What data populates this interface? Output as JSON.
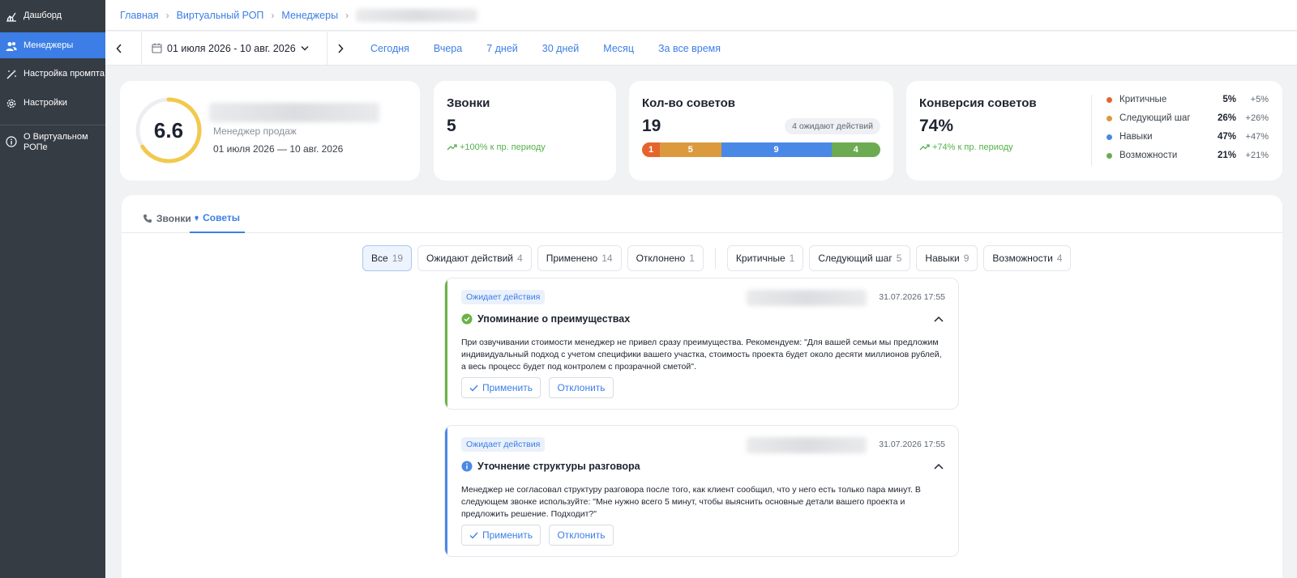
{
  "sidebar": {
    "items": [
      {
        "label": "Дашборд",
        "icon": "chart-icon"
      },
      {
        "label": "Менеджеры",
        "icon": "users-icon"
      },
      {
        "label": "Настройка промпта",
        "icon": "magic-wand-icon"
      },
      {
        "label": "Настройки",
        "icon": "gear-icon"
      },
      {
        "label": "О Виртуальном РОПе",
        "icon": "info-icon"
      }
    ]
  },
  "breadcrumb": {
    "items": [
      "Главная",
      "Виртуальный РОП",
      "Менеджеры"
    ]
  },
  "datebar": {
    "range": "01 июля 2026 - 10 авг. 2026",
    "quick": [
      "Сегодня",
      "Вчера",
      "7 дней",
      "30 дней",
      "Месяц",
      "За все время"
    ]
  },
  "manager": {
    "score": "6.6",
    "score_fraction": 0.66,
    "role": "Менеджер продаж",
    "period": "01 июля 2026 — 10 авг. 2026"
  },
  "calls": {
    "title": "Звонки",
    "value": "5",
    "trend": "+100% к пр. периоду"
  },
  "advices_count": {
    "title": "Кол-во советов",
    "value": "19",
    "pending": "4 ожидают действий",
    "segments": [
      {
        "value": 1,
        "color": "#e5642d"
      },
      {
        "value": 5,
        "color": "#dc9a3e"
      },
      {
        "value": 9,
        "color": "#4a88e6"
      },
      {
        "value": 4,
        "color": "#6cab52"
      }
    ]
  },
  "conversion": {
    "title": "Конверсия советов",
    "value": "74%",
    "trend": "+74% к пр. периоду",
    "legend": [
      {
        "label": "Критичные",
        "pct": "5%",
        "change": "+5%",
        "color": "#e5642d"
      },
      {
        "label": "Следующий шаг",
        "pct": "26%",
        "change": "+26%",
        "color": "#dc9a3e"
      },
      {
        "label": "Навыки",
        "pct": "47%",
        "change": "+47%",
        "color": "#4a88e6"
      },
      {
        "label": "Возможности",
        "pct": "21%",
        "change": "+21%",
        "color": "#6cab52"
      }
    ]
  },
  "tabs": [
    {
      "label": "Звонки",
      "icon": "phone-icon"
    },
    {
      "label": "Советы",
      "icon": "lightbulb-icon"
    }
  ],
  "filters": [
    {
      "label": "Все",
      "count": "19"
    },
    {
      "label": "Ожидают действий",
      "count": "4"
    },
    {
      "label": "Применено",
      "count": "14"
    },
    {
      "label": "Отклонено",
      "count": "1"
    },
    {
      "label": "Критичные",
      "count": "1"
    },
    {
      "label": "Следующий шаг",
      "count": "5"
    },
    {
      "label": "Навыки",
      "count": "9"
    },
    {
      "label": "Возможности",
      "count": "4"
    }
  ],
  "advices": [
    {
      "status": "Ожидает действия",
      "date": "31.07.2026 17:55",
      "title": "Упоминание о преимуществах",
      "icon": "check-circle-icon",
      "color": "#6cb245",
      "text": "При озвучивании стоимости менеджер не привел сразу преимущества. Рекомендуем: \"Для вашей семьи мы предложим индивидуальный подход с учетом специфики вашего участка, стоимость проекта будет около десяти миллионов рублей, а весь процесс будет под контролем с прозрачной сметой\".",
      "apply": "Применить",
      "reject": "Отклонить"
    },
    {
      "status": "Ожидает действия",
      "date": "31.07.2026 17:55",
      "title": "Уточнение структуры разговора",
      "icon": "info-circle-icon",
      "color": "#4a88e6",
      "text": "Менеджер не согласовал структуру разговора после того, как клиент сообщил, что у него есть только пара минут. В следующем звонке используйте: \"Мне нужно всего 5 минут, чтобы выяснить основные детали вашего проекта и предложить решение. Подходит?\"",
      "apply": "Применить",
      "reject": "Отклонить"
    }
  ]
}
